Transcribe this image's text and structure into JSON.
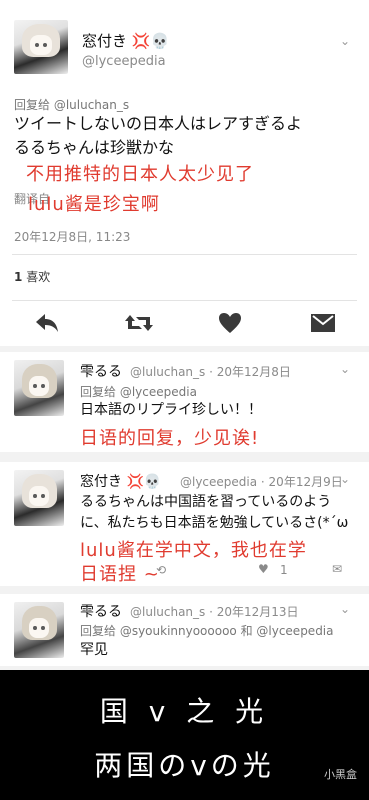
{
  "main": {
    "display_name": "窓付き 💢💀",
    "handle": "@lyceepedia",
    "reply_to": "回复给 @luluchan_s",
    "text_line1": "ツイートしないの日本人はレアすぎるよ",
    "text_line2": "るるちゃんは珍獣かな",
    "translate": "翻译自",
    "annot1": "不用推特的日本人太少见了",
    "annot2": "lulu酱是珍宝啊",
    "timestamp": "20年12月8日, 11:23",
    "likes_count": "1",
    "likes_label": "喜欢",
    "icons": {
      "reply": "reply-icon",
      "retweet": "retweet-icon",
      "like": "heart-icon",
      "mail": "mail-icon"
    }
  },
  "replies": [
    {
      "name": "雫るる",
      "handle_date": "@luluchan_s · 20年12月8日",
      "reply_to": "回复给 @lyceepedia",
      "text": "日本語のリプライ珍しい！！",
      "annot": "日语的回复，少见诶!"
    },
    {
      "name": "窓付き 💢💀",
      "handle_date": "@lyceepedia · 20年12月9日",
      "text_line1": "るるちゃんは中国語を習っているのよう",
      "text_line2": "に、私たちも日本語を勉強しているさ(*´ω",
      "annot_line1": "lulu酱在学中文，我也在学",
      "annot_line2": "日语捏 ~",
      "like_count": "1"
    },
    {
      "name": "雫るる",
      "handle_date": "@luluchan_s · 20年12月13日",
      "reply_to": "回复给 @syoukinnyoooooo 和 @lyceepedia",
      "text": "罕见"
    }
  ],
  "caption": {
    "line1": "国 v 之 光",
    "line2": "两国のvの光",
    "watermark": "小黑盒"
  }
}
